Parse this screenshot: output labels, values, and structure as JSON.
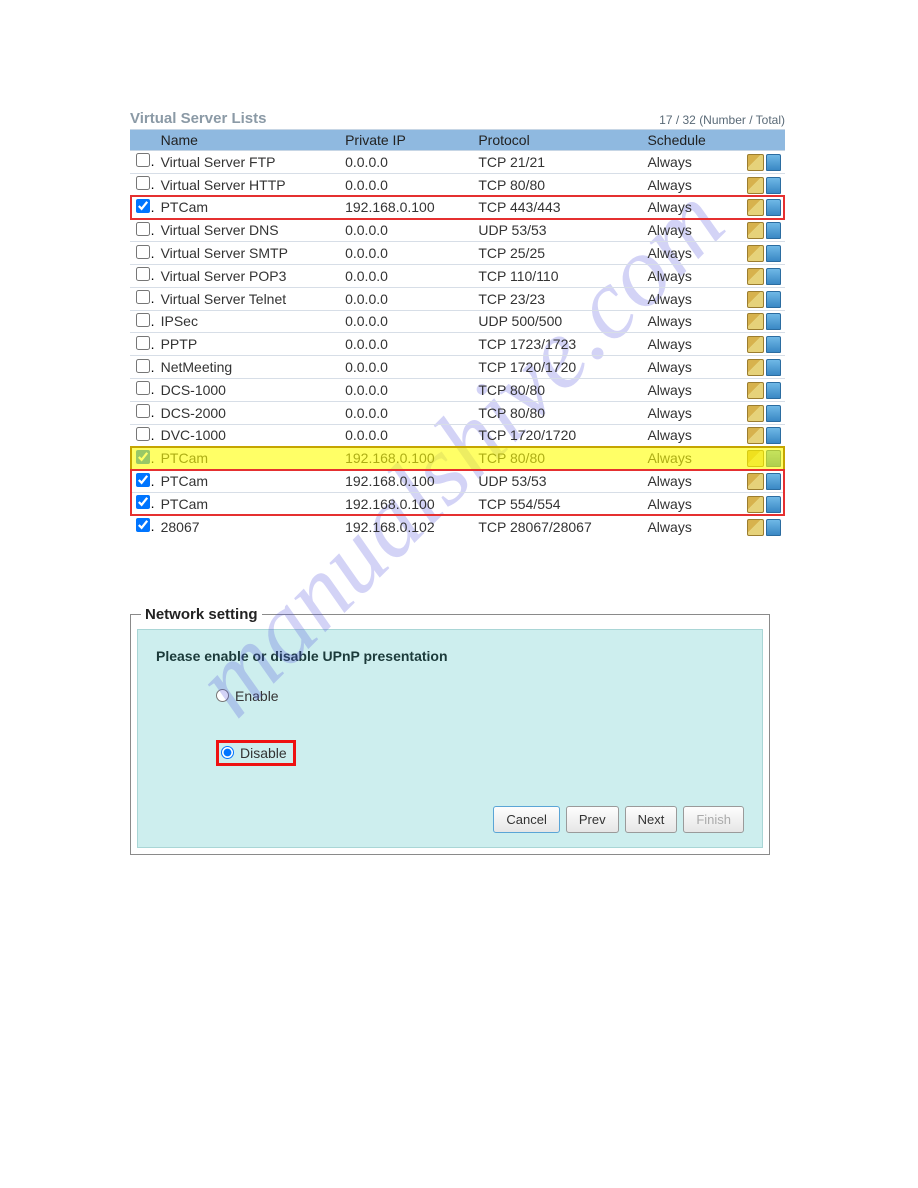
{
  "watermark": "manualshive.com",
  "vsl": {
    "title": "Virtual Server Lists",
    "count_label": "17 / 32 (Number / Total)",
    "cols": {
      "name": "Name",
      "ip": "Private IP",
      "proto": "Protocol",
      "sched": "Schedule"
    },
    "rows": [
      {
        "chk": false,
        "name": "Virtual Server FTP",
        "ip": "0.0.0.0",
        "proto": "TCP 21/21",
        "sched": "Always",
        "group": ""
      },
      {
        "chk": false,
        "name": "Virtual Server HTTP",
        "ip": "0.0.0.0",
        "proto": "TCP 80/80",
        "sched": "Always",
        "group": ""
      },
      {
        "chk": true,
        "name": "PTCam",
        "ip": "192.168.0.100",
        "proto": "TCP 443/443",
        "sched": "Always",
        "group": "red1"
      },
      {
        "chk": false,
        "name": "Virtual Server DNS",
        "ip": "0.0.0.0",
        "proto": "UDP 53/53",
        "sched": "Always",
        "group": ""
      },
      {
        "chk": false,
        "name": "Virtual Server SMTP",
        "ip": "0.0.0.0",
        "proto": "TCP 25/25",
        "sched": "Always",
        "group": ""
      },
      {
        "chk": false,
        "name": "Virtual Server POP3",
        "ip": "0.0.0.0",
        "proto": "TCP 110/110",
        "sched": "Always",
        "group": ""
      },
      {
        "chk": false,
        "name": "Virtual Server Telnet",
        "ip": "0.0.0.0",
        "proto": "TCP 23/23",
        "sched": "Always",
        "group": ""
      },
      {
        "chk": false,
        "name": "IPSec",
        "ip": "0.0.0.0",
        "proto": "UDP 500/500",
        "sched": "Always",
        "group": ""
      },
      {
        "chk": false,
        "name": "PPTP",
        "ip": "0.0.0.0",
        "proto": "TCP 1723/1723",
        "sched": "Always",
        "group": ""
      },
      {
        "chk": false,
        "name": "NetMeeting",
        "ip": "0.0.0.0",
        "proto": "TCP 1720/1720",
        "sched": "Always",
        "group": ""
      },
      {
        "chk": false,
        "name": "DCS-1000",
        "ip": "0.0.0.0",
        "proto": "TCP 80/80",
        "sched": "Always",
        "group": ""
      },
      {
        "chk": false,
        "name": "DCS-2000",
        "ip": "0.0.0.0",
        "proto": "TCP 80/80",
        "sched": "Always",
        "group": ""
      },
      {
        "chk": false,
        "name": "DVC-1000",
        "ip": "0.0.0.0",
        "proto": "TCP 1720/1720",
        "sched": "Always",
        "group": ""
      },
      {
        "chk": true,
        "name": "PTCam",
        "ip": "192.168.0.100",
        "proto": "TCP 80/80",
        "sched": "Always",
        "group": "yellow"
      },
      {
        "chk": true,
        "name": "PTCam",
        "ip": "192.168.0.100",
        "proto": "UDP 53/53",
        "sched": "Always",
        "group": "red2"
      },
      {
        "chk": true,
        "name": "PTCam",
        "ip": "192.168.0.100",
        "proto": "TCP 554/554",
        "sched": "Always",
        "group": "red2"
      },
      {
        "chk": true,
        "name": "28067",
        "ip": "192.168.0.102",
        "proto": "TCP 28067/28067",
        "sched": "Always",
        "group": ""
      }
    ]
  },
  "panel": {
    "legend": "Network setting",
    "prompt": "Please enable or disable UPnP presentation",
    "enable_label": "Enable",
    "disable_label": "Disable",
    "selected": "disable",
    "buttons": {
      "cancel": "Cancel",
      "prev": "Prev",
      "next": "Next",
      "finish": "Finish"
    }
  }
}
